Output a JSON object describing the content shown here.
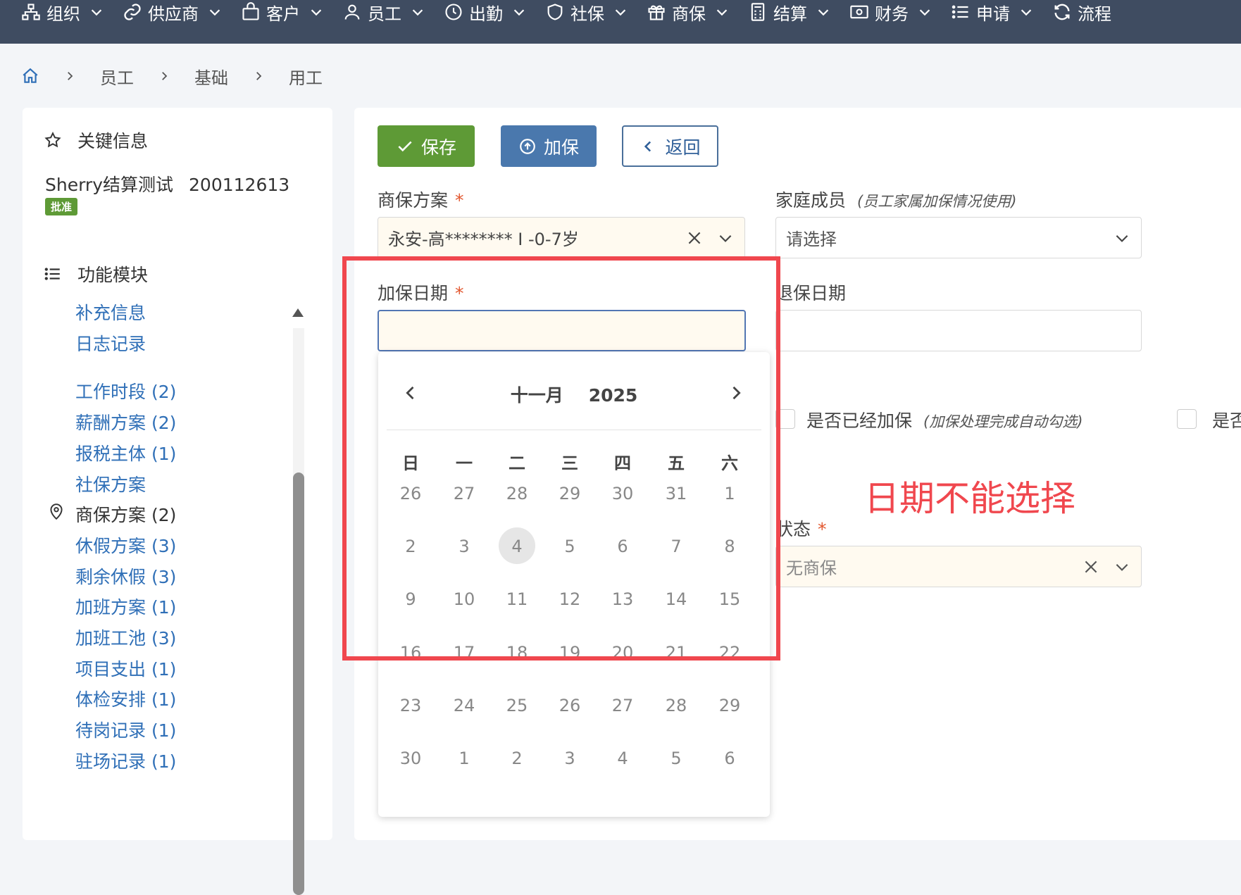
{
  "nav": [
    {
      "label": "组织",
      "icon": "sitemap-icon"
    },
    {
      "label": "供应商",
      "icon": "link-icon"
    },
    {
      "label": "客户",
      "icon": "bag-icon"
    },
    {
      "label": "员工",
      "icon": "user-icon"
    },
    {
      "label": "出勤",
      "icon": "clock-icon"
    },
    {
      "label": "社保",
      "icon": "shield-icon"
    },
    {
      "label": "商保",
      "icon": "gift-icon"
    },
    {
      "label": "结算",
      "icon": "calculator-icon"
    },
    {
      "label": "财务",
      "icon": "money-icon"
    },
    {
      "label": "申请",
      "icon": "list-icon"
    },
    {
      "label": "流程",
      "icon": "refresh-icon"
    }
  ],
  "breadcrumb": [
    "员工",
    "基础",
    "用工"
  ],
  "left": {
    "key_info_title": "关键信息",
    "employee_name": "Sherry结算测试",
    "employee_id": "200112613",
    "status_badge": "批准",
    "modules_title": "功能模块",
    "modules": [
      {
        "label": "补充信息",
        "current": false
      },
      {
        "label": "日志记录",
        "current": false
      },
      {
        "label": "工作时段 (2)",
        "current": false
      },
      {
        "label": "薪酬方案 (2)",
        "current": false
      },
      {
        "label": "报税主体 (1)",
        "current": false
      },
      {
        "label": "社保方案",
        "current": false
      },
      {
        "label": "商保方案 (2)",
        "current": true
      },
      {
        "label": "休假方案 (3)",
        "current": false
      },
      {
        "label": "剩余休假 (3)",
        "current": false
      },
      {
        "label": "加班方案 (1)",
        "current": false
      },
      {
        "label": "加班工池 (3)",
        "current": false
      },
      {
        "label": "项目支出 (1)",
        "current": false
      },
      {
        "label": "体检安排 (1)",
        "current": false
      },
      {
        "label": "待岗记录 (1)",
        "current": false
      },
      {
        "label": "驻场记录 (1)",
        "current": false
      }
    ]
  },
  "toolbar": {
    "save_label": "保存",
    "add_insurance_label": "加保",
    "back_label": "返回"
  },
  "form": {
    "plan_label": "商保方案",
    "plan_value": "永安-高******** Ⅰ -0-7岁",
    "family_label": "家庭成员",
    "family_hint": "(员工家属加保情况使用)",
    "family_placeholder": "请选择",
    "add_date_label": "加保日期",
    "add_date_value": "",
    "withdraw_date_label": "退保日期",
    "withdraw_date_value": "",
    "added_check_label": "是否已经加保",
    "added_check_hint": "(加保处理完成自动勾选)",
    "second_check_label": "是否",
    "status_label": "状态",
    "status_value": "无商保",
    "required_mark": "*"
  },
  "annotation": "日期不能选择",
  "calendar": {
    "month": "十一月",
    "year": "2025",
    "weekdays": [
      "日",
      "一",
      "二",
      "三",
      "四",
      "五",
      "六"
    ],
    "weeks": [
      [
        "26",
        "27",
        "28",
        "29",
        "30",
        "31",
        "1"
      ],
      [
        "2",
        "3",
        "4",
        "5",
        "6",
        "7",
        "8"
      ],
      [
        "9",
        "10",
        "11",
        "12",
        "13",
        "14",
        "15"
      ],
      [
        "16",
        "17",
        "18",
        "19",
        "20",
        "21",
        "22"
      ],
      [
        "23",
        "24",
        "25",
        "26",
        "27",
        "28",
        "29"
      ],
      [
        "30",
        "1",
        "2",
        "3",
        "4",
        "5",
        "6"
      ]
    ],
    "highlighted_day": "4"
  },
  "colors": {
    "nav_bg": "#3f4c61",
    "save_green": "#5e9a36",
    "add_blue": "#4a78ad",
    "link_blue": "#2f6fb7",
    "annotation_red": "#f0474e",
    "required_orange": "#e2562e"
  }
}
